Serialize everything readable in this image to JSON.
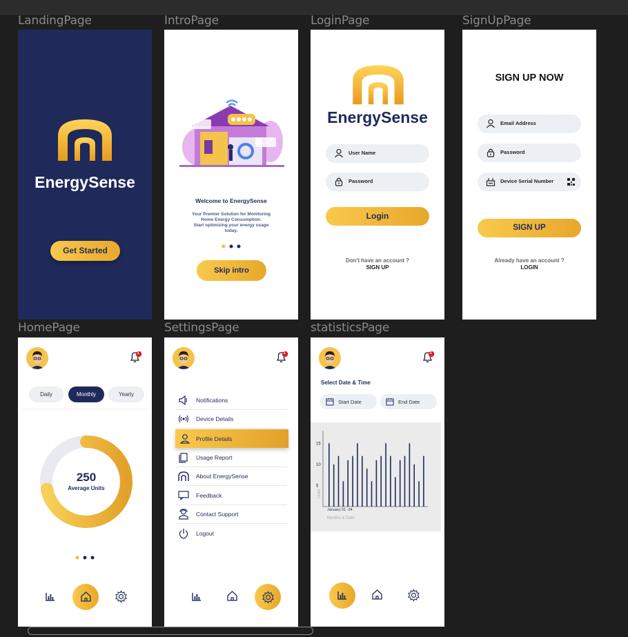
{
  "frames": {
    "landing": {
      "label": "LandingPage"
    },
    "intro": {
      "label": "IntroPage"
    },
    "login": {
      "label": "LoginPage"
    },
    "signup": {
      "label": "SignUpPage"
    },
    "home": {
      "label": "HomePage"
    },
    "settings": {
      "label": "SettingsPage"
    },
    "statistics": {
      "label": "statisticsPage"
    }
  },
  "brand": {
    "name": "EnergySense"
  },
  "landing": {
    "cta": "Get Started"
  },
  "intro": {
    "title": "Welcome to EnergySense",
    "body1": "Your Premier Solution for Monitoring",
    "body2": "Home Energy Consumption.",
    "body3": "Start optimizing your energy usage",
    "body4": "today.",
    "cta": "Skip intro"
  },
  "login": {
    "username_placeholder": "User Name",
    "password_placeholder": "Password",
    "login_button": "Login",
    "no_account": "Don't have an account ?",
    "signup_link": "SIGN UP"
  },
  "signup": {
    "title": "SIGN UP NOW",
    "email_placeholder": "Email Address",
    "password_placeholder": "Password",
    "serial_placeholder": "Device Serial Number",
    "signup_button": "SIGN UP",
    "have_account": "Already have an account ?",
    "login_link": "LOGIN"
  },
  "home": {
    "tabs": [
      "Daily",
      "Monthly",
      "Yearly"
    ],
    "active_tab": "Monthly",
    "gauge_value": "250",
    "gauge_label": "Average Units",
    "gauge_fraction": 0.72,
    "notification_count": "1"
  },
  "settings": {
    "items": [
      {
        "label": "Notifications",
        "icon": "speaker-icon"
      },
      {
        "label": "Device Details",
        "icon": "signal-icon"
      },
      {
        "label": "Profile Details",
        "icon": "user-icon"
      },
      {
        "label": "Usage Report",
        "icon": "document-icon"
      },
      {
        "label": "About EnergySense",
        "icon": "logo-arch-icon"
      },
      {
        "label": "Feedback",
        "icon": "feedback-icon"
      },
      {
        "label": "Contact Support",
        "icon": "support-icon"
      },
      {
        "label": "Logout",
        "icon": "power-icon"
      }
    ],
    "active_item": "Profile Details"
  },
  "statistics": {
    "select_label": "Select Date & Time",
    "start_date": "Start Date",
    "end_date": "End Date"
  },
  "chart_data": {
    "type": "bar",
    "title": "",
    "xlabel": "Months & Date",
    "ylabel": "Units",
    "x_tick_label": "January 01 -24",
    "yticks": [
      5,
      10,
      15
    ],
    "ylim": [
      0,
      18
    ],
    "values": [
      15,
      10,
      12,
      6,
      11,
      12,
      15,
      12,
      9,
      6,
      11,
      12,
      15,
      12,
      7,
      11,
      12,
      15,
      10,
      6,
      12
    ]
  },
  "colors": {
    "navy": "#1f2a5a",
    "gold": "#f3bb3c",
    "gold_dark": "#e2a12a",
    "badge_red": "#e0182d"
  }
}
